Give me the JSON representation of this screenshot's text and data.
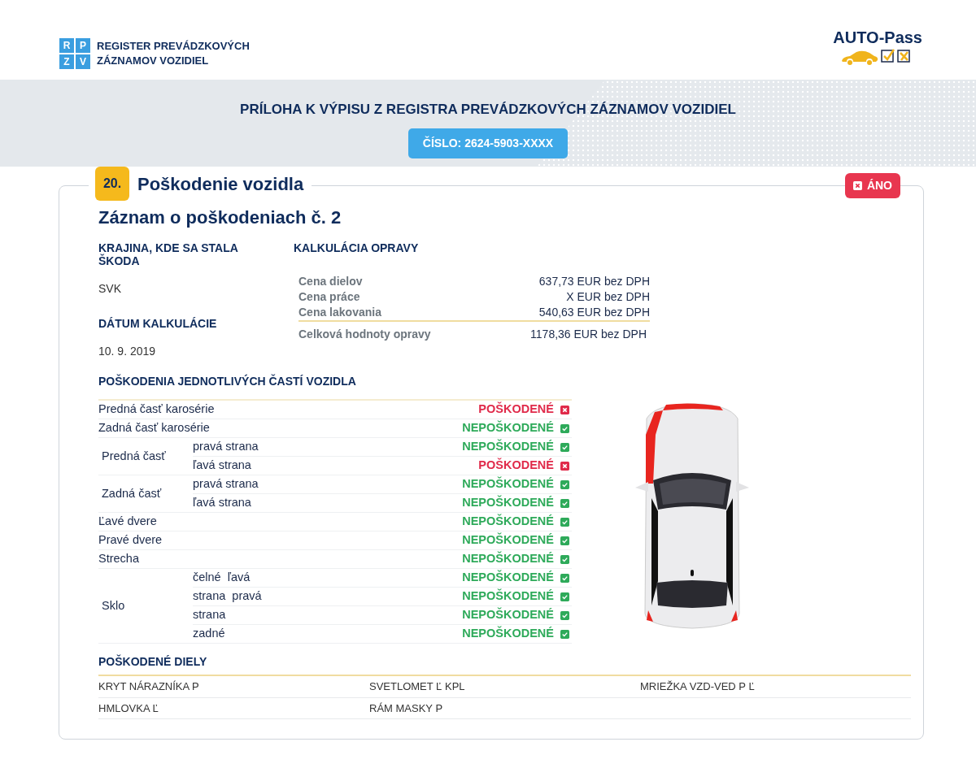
{
  "header": {
    "logo_letters": [
      "R",
      "P",
      "Z",
      "V"
    ],
    "logo_text_lines": [
      "REGISTER PREVÁDZKOVÝCH",
      "ZÁZNAMOV VOZIDIEL"
    ],
    "brand": "AUTO-Pass"
  },
  "banner": {
    "title": "PRÍLOHA K VÝPISU Z REGISTRA PREVÁDZKOVÝCH ZÁZNAMOV VOZIDIEL",
    "number": "ČÍSLO: 2624-5903-XXXX"
  },
  "section": {
    "number": "20.",
    "title": "Poškodenie vozidla",
    "badge": "ÁNO"
  },
  "record_title": "Záznam o poškodeniach č. 2",
  "country": {
    "label": "KRAJINA, KDE SA STALA ŠKODA",
    "value": "SVK"
  },
  "date": {
    "label": "DÁTUM KALKULÁCIE",
    "value": "10. 9. 2019"
  },
  "calculation": {
    "label": "KALKULÁCIA OPRAVY",
    "rows": [
      {
        "label": "Cena dielov",
        "value": "637,73 EUR bez DPH"
      },
      {
        "label": "Cena práce",
        "value": "X EUR bez DPH"
      },
      {
        "label": "Cena lakovania",
        "value": "540,63 EUR bez DPH"
      }
    ],
    "total": {
      "label": "Celková hodnoty opravy",
      "value": "1178,36 EUR bez DPH"
    }
  },
  "damage": {
    "label": "POŠKODENIA JEDNOTLIVÝCH ČASTÍ VOZIDLA",
    "groups": [
      {
        "label": "Predná časť karosérie",
        "status": "POŠKODENÉ",
        "damaged": true
      },
      {
        "label": "Zadná časť karosérie",
        "status": "NEPOŠKODENÉ",
        "damaged": false
      },
      {
        "label": "Predná časť",
        "children": [
          {
            "label": "pravá strana",
            "status": "NEPOŠKODENÉ",
            "damaged": false
          },
          {
            "label": "ľavá strana",
            "status": "POŠKODENÉ",
            "damaged": true
          }
        ]
      },
      {
        "label": "Zadná časť",
        "children": [
          {
            "label": "pravá strana",
            "status": "NEPOŠKODENÉ",
            "damaged": false
          },
          {
            "label": "ľavá strana",
            "status": "NEPOŠKODENÉ",
            "damaged": false
          }
        ]
      },
      {
        "label": "Ľavé dvere",
        "status": "NEPOŠKODENÉ",
        "damaged": false
      },
      {
        "label": "Pravé dvere",
        "status": "NEPOŠKODENÉ",
        "damaged": false
      },
      {
        "label": "Strecha",
        "status": "NEPOŠKODENÉ",
        "damaged": false
      },
      {
        "label": "Sklo",
        "children": [
          {
            "label": "čelné  ľavá",
            "status": "NEPOŠKODENÉ",
            "damaged": false
          },
          {
            "label": "strana  pravá",
            "status": "NEPOŠKODENÉ",
            "damaged": false
          },
          {
            "label": "strana",
            "status": "NEPOŠKODENÉ",
            "damaged": false
          },
          {
            "label": "zadné",
            "status": "NEPOŠKODENÉ",
            "damaged": false
          }
        ]
      }
    ]
  },
  "damaged_parts": {
    "label": "POŠKODENÉ DIELY",
    "items": [
      "KRYT NÁRAZNÍKA P",
      "SVETLOMET Ľ KPL",
      "MRIEŽKA VZD-VED P Ľ",
      "HMLOVKA Ľ",
      "RÁM MASKY P"
    ]
  }
}
